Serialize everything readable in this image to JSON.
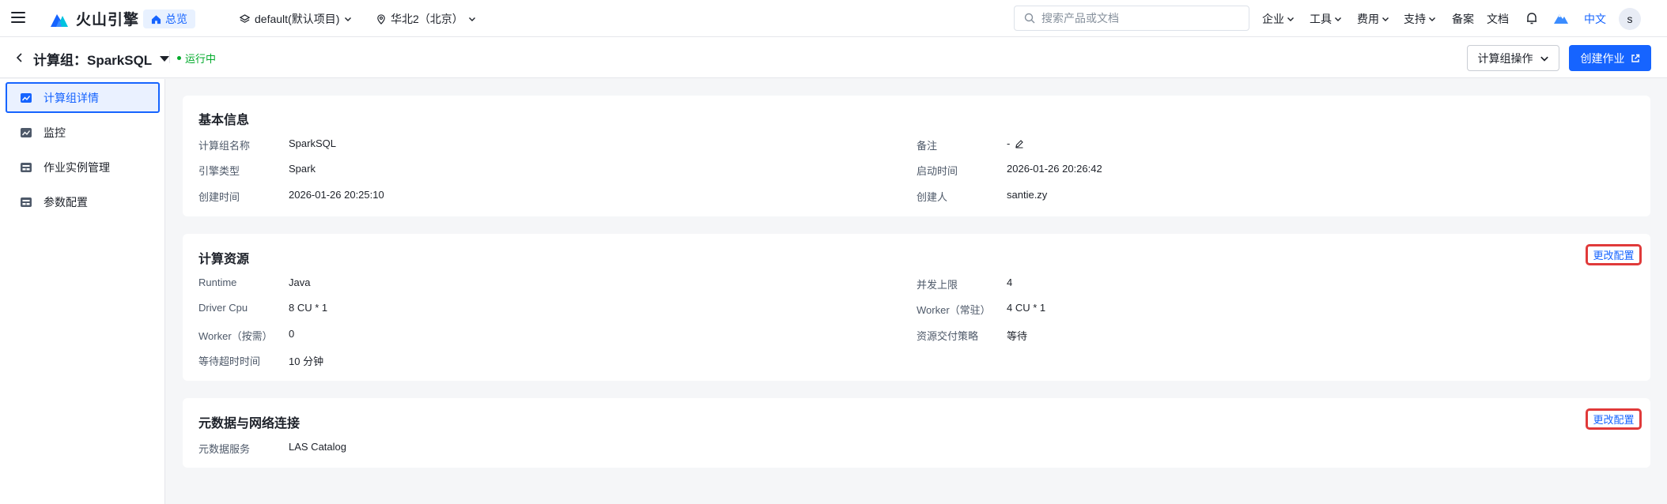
{
  "nav": {
    "brand": "火山引擎",
    "overview": "总览",
    "project": "default(默认项目)",
    "region": "华北2（北京）",
    "search_placeholder": "搜索产品或文档",
    "menu": [
      "企业",
      "工具",
      "费用",
      "支持"
    ],
    "links": [
      "备案",
      "文档"
    ],
    "lang": "中文",
    "avatar": "s"
  },
  "header": {
    "title": "计算组：SparkSQL",
    "status": "运行中",
    "ops_button": "计算组操作",
    "create_button": "创建作业"
  },
  "sidebar": {
    "items": [
      {
        "label": "计算组详情",
        "icon": "detail-icon",
        "active": true
      },
      {
        "label": "监控",
        "icon": "monitor-icon",
        "active": false
      },
      {
        "label": "作业实例管理",
        "icon": "job-instance-icon",
        "active": false
      },
      {
        "label": "参数配置",
        "icon": "param-config-icon",
        "active": false
      }
    ]
  },
  "basic": {
    "title": "基本信息",
    "left": [
      {
        "label": "计算组名称",
        "value": "SparkSQL"
      },
      {
        "label": "引擎类型",
        "value": "Spark"
      },
      {
        "label": "创建时间",
        "value": "2026-01-26 20:25:10"
      }
    ],
    "right": [
      {
        "label": "备注",
        "value": "-"
      },
      {
        "label": "启动时间",
        "value": "2026-01-26 20:26:42"
      },
      {
        "label": "创建人",
        "value": "santie.zy"
      }
    ]
  },
  "resources": {
    "title": "计算资源",
    "config_button": "更改配置",
    "left": [
      {
        "label": "Runtime",
        "value": "Java"
      },
      {
        "label": "Driver Cpu",
        "value": "8 CU * 1"
      },
      {
        "label": "Worker（按需）",
        "value": "0"
      },
      {
        "label": "等待超时时间",
        "value": "10 分钟"
      }
    ],
    "right": [
      {
        "label": "并发上限",
        "value": "4"
      },
      {
        "label": "Worker（常驻）",
        "value": "4 CU * 1"
      },
      {
        "label": "资源交付策略",
        "value": "等待"
      }
    ]
  },
  "metadata": {
    "title": "元数据与网络连接",
    "config_button": "更改配置",
    "left": [
      {
        "label": "元数据服务",
        "value": "LAS Catalog"
      }
    ]
  },
  "colors": {
    "primary": "#1664ff",
    "status_green": "#00aa2a",
    "highlight_red": "#e03a3a"
  }
}
